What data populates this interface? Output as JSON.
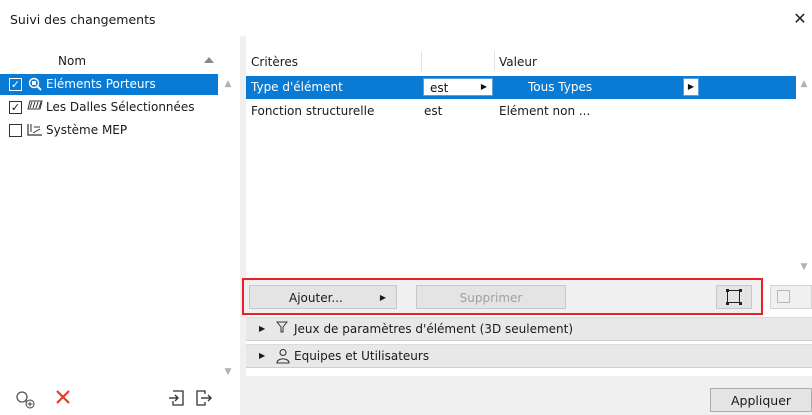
{
  "window": {
    "title": "Suivi des changements",
    "close_glyph": "✕"
  },
  "left_panel": {
    "column_header": "Nom",
    "items": [
      {
        "label": "Eléments Porteurs",
        "checked": true,
        "icon": "magnifier-structure-icon",
        "selected": true
      },
      {
        "label": "Les Dalles Sélectionnées",
        "checked": true,
        "icon": "slab-icon",
        "selected": false
      },
      {
        "label": "Système MEP",
        "checked": false,
        "icon": "mep-system-icon",
        "selected": false
      }
    ],
    "toolbar": {
      "add_icon": "add-set-icon",
      "delete_icon": "delete-icon",
      "import_icon": "import-icon",
      "export_icon": "export-icon"
    }
  },
  "criteria_grid": {
    "headers": {
      "criteria": "Critères",
      "value": "Valeur"
    },
    "rows": [
      {
        "criterion": "Type d'élément",
        "operator": "est",
        "value": "Tous Types",
        "selected": true
      },
      {
        "criterion": "Fonction structurelle",
        "operator": "est",
        "value": "Elément non ...",
        "selected": false
      }
    ]
  },
  "action_bar": {
    "add_label": "Ajouter...",
    "delete_label": "Supprimer",
    "select_icon": "selection-frame-icon"
  },
  "sections": [
    {
      "label": "Jeux de paramètres d'élément (3D seulement)",
      "icon": "filter-icon"
    },
    {
      "label": "Equipes et Utilisateurs",
      "icon": "user-icon"
    }
  ],
  "footer": {
    "apply_label": "Appliquer"
  },
  "colors": {
    "selection": "#0a7bd4",
    "highlight_border": "#e8202a",
    "delete_red": "#e53b2c"
  }
}
